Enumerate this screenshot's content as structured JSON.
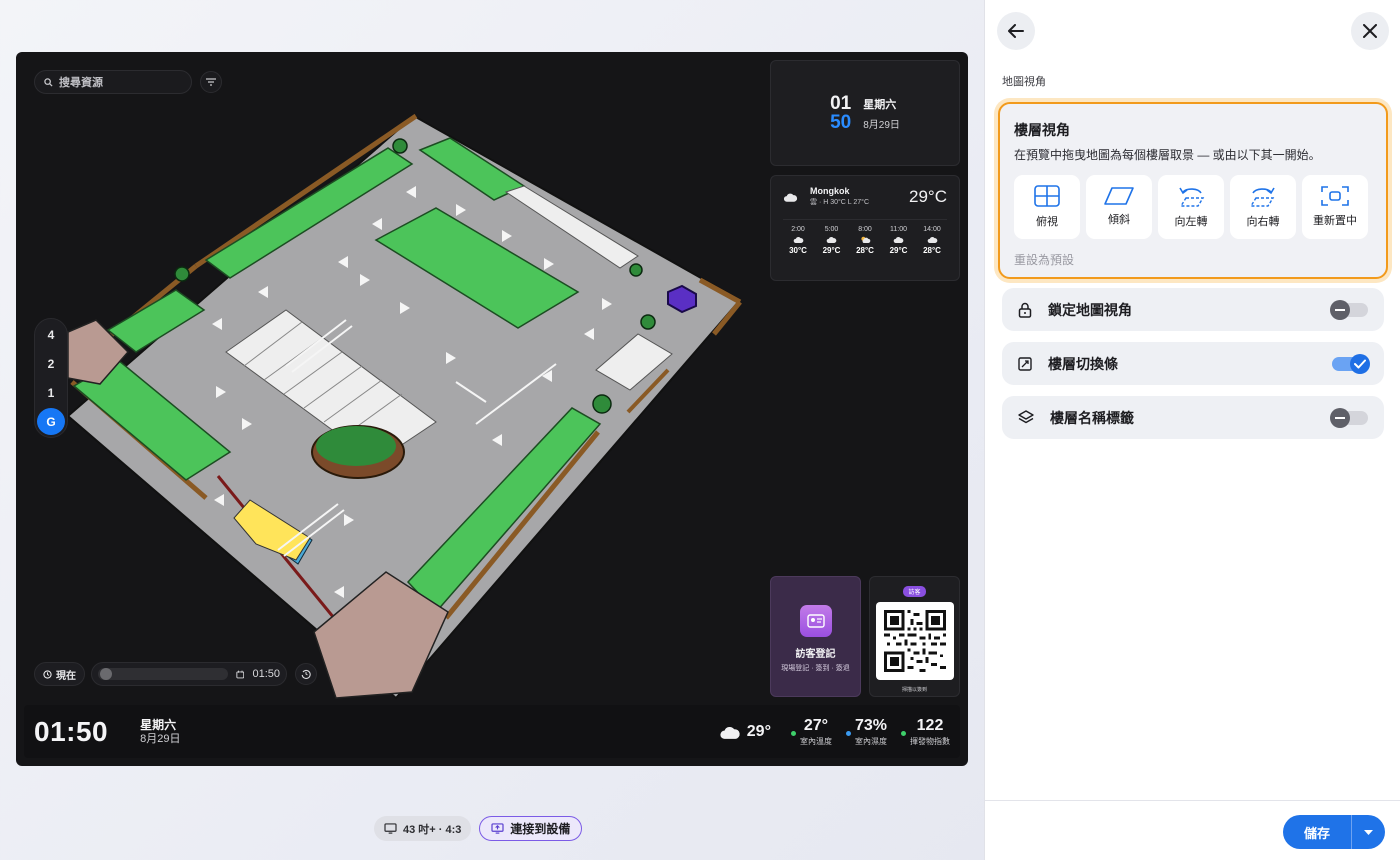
{
  "preview": {
    "search_placeholder": "搜尋資源",
    "floors": [
      "4",
      "2",
      "1",
      "G"
    ],
    "active_floor": "G",
    "time_control": {
      "now_label": "現在",
      "time": "01:50"
    }
  },
  "widgets": {
    "clock": {
      "hour": "01",
      "minute": "50",
      "weekday": "星期六",
      "date": "8月29日"
    },
    "weather": {
      "city": "Mongkok",
      "summary": "雲 · H 30°C L 27°C",
      "current_temp": "29°C",
      "hourly": [
        {
          "time": "2:00",
          "icon": "cloud-night-icon",
          "temp": "30°C"
        },
        {
          "time": "5:00",
          "icon": "cloud-night-icon",
          "temp": "29°C"
        },
        {
          "time": "8:00",
          "icon": "partly-sunny-icon",
          "temp": "28°C"
        },
        {
          "time": "11:00",
          "icon": "cloud-icon",
          "temp": "29°C"
        },
        {
          "time": "14:00",
          "icon": "cloud-icon",
          "temp": "28°C"
        }
      ]
    },
    "visitor": {
      "title": "訪客登記",
      "subtitle": "現場登記 · 簽到 · 簽退"
    },
    "qr": {
      "badge": "訪客",
      "caption": "掃描以簽到"
    }
  },
  "bottom_bar": {
    "time": "01:50",
    "weekday": "星期六",
    "date": "8月29日",
    "weather_temp": "29°",
    "metrics": [
      {
        "value": "27°",
        "label": "室內溫度",
        "color": "#3ecf6a"
      },
      {
        "value": "73%",
        "label": "室內濕度",
        "color": "#3a9af0"
      },
      {
        "value": "122",
        "label": "揮發物指數",
        "color": "#3ecf6a"
      }
    ]
  },
  "device_bar": {
    "display": "43 吋+ · 4:3",
    "connect": "連接到設備"
  },
  "panel": {
    "section_label": "地圖視角",
    "view_card": {
      "title": "樓層視角",
      "description": "在預覽中拖曳地圖為每個樓層取景 — 或由以下其一開始。",
      "buttons": [
        {
          "label": "俯視",
          "icon": "top-view-icon"
        },
        {
          "label": "傾斜",
          "icon": "tilt-icon"
        },
        {
          "label": "向左轉",
          "icon": "rotate-left-icon"
        },
        {
          "label": "向右轉",
          "icon": "rotate-right-icon"
        },
        {
          "label": "重新置中",
          "icon": "recenter-icon"
        }
      ],
      "reset_label": "重設為預設"
    },
    "toggles": [
      {
        "label": "鎖定地圖視角",
        "icon": "lock-icon",
        "on": false
      },
      {
        "label": "樓層切換條",
        "icon": "floor-switch-icon",
        "on": true
      },
      {
        "label": "樓層名稱標籤",
        "icon": "layers-icon",
        "on": false
      }
    ],
    "save_label": "儲存"
  },
  "colors": {
    "accent": "#1f73e8",
    "highlight": "#f29a1b",
    "parking": "#4cc45a"
  }
}
